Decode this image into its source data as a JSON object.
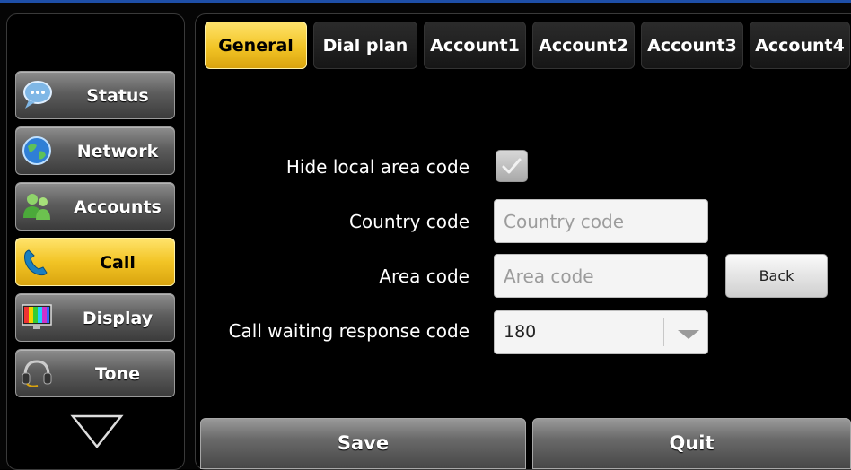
{
  "sidebar": {
    "items": [
      {
        "label": "Status",
        "icon": "chat-bubble-icon"
      },
      {
        "label": "Network",
        "icon": "globe-icon"
      },
      {
        "label": "Accounts",
        "icon": "users-icon"
      },
      {
        "label": "Call",
        "icon": "phone-handset-icon",
        "active": true
      },
      {
        "label": "Display",
        "icon": "monitor-icon"
      },
      {
        "label": "Tone",
        "icon": "headset-icon"
      }
    ],
    "scroll_icon": "triangle-down-icon"
  },
  "tabs": [
    {
      "label": "General",
      "active": true
    },
    {
      "label": "Dial plan"
    },
    {
      "label": "Account1"
    },
    {
      "label": "Account2"
    },
    {
      "label": "Account3"
    },
    {
      "label": "Account4"
    }
  ],
  "form": {
    "hide_local_area_code": {
      "label": "Hide local area code",
      "checked": true
    },
    "country_code": {
      "label": "Country code",
      "placeholder": "Country code",
      "value": ""
    },
    "area_code": {
      "label": "Area code",
      "placeholder": "Area code",
      "value": ""
    },
    "call_waiting": {
      "label": "Call waiting response code",
      "value": "180"
    }
  },
  "buttons": {
    "back": "Back",
    "save": "Save",
    "quit": "Quit"
  },
  "colors": {
    "accent": "#f2c425",
    "top_bar": "#1e4fa8",
    "background": "#000000"
  }
}
